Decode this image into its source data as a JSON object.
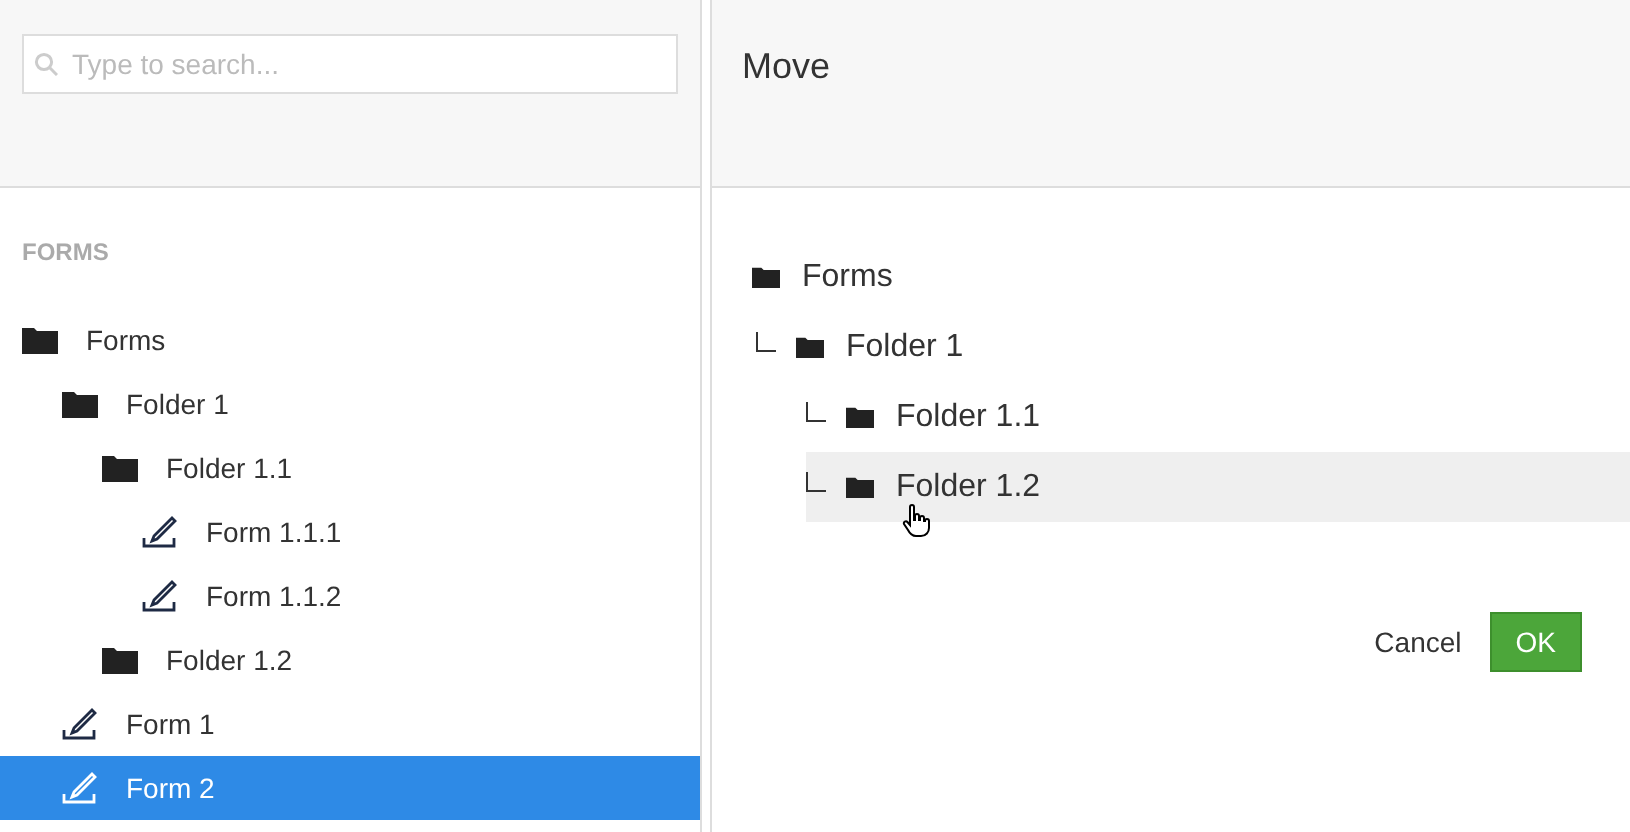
{
  "search": {
    "placeholder": "Type to search..."
  },
  "section_label": "FORMS",
  "tree": [
    {
      "kind": "folder",
      "label": "Forms",
      "selected": false,
      "children": [
        {
          "kind": "folder",
          "label": "Folder 1",
          "selected": false,
          "children": [
            {
              "kind": "folder",
              "label": "Folder 1.1",
              "selected": false,
              "children": [
                {
                  "kind": "form",
                  "label": "Form 1.1.1",
                  "selected": false
                },
                {
                  "kind": "form",
                  "label": "Form 1.1.2",
                  "selected": false
                }
              ]
            },
            {
              "kind": "folder",
              "label": "Folder 1.2",
              "selected": false
            }
          ]
        },
        {
          "kind": "form",
          "label": "Form 1",
          "selected": false
        },
        {
          "kind": "form",
          "label": "Form 2",
          "selected": true
        }
      ]
    }
  ],
  "dialog": {
    "title": "Move",
    "tree": [
      {
        "label": "Forms",
        "highlighted": false,
        "children": [
          {
            "label": "Folder 1",
            "highlighted": false,
            "children": [
              {
                "label": "Folder 1.1",
                "highlighted": false
              },
              {
                "label": "Folder 1.2",
                "highlighted": true
              }
            ]
          }
        ]
      }
    ],
    "buttons": [
      {
        "kind": "link",
        "label": "Cancel"
      },
      {
        "kind": "primary",
        "label": "OK"
      }
    ]
  }
}
